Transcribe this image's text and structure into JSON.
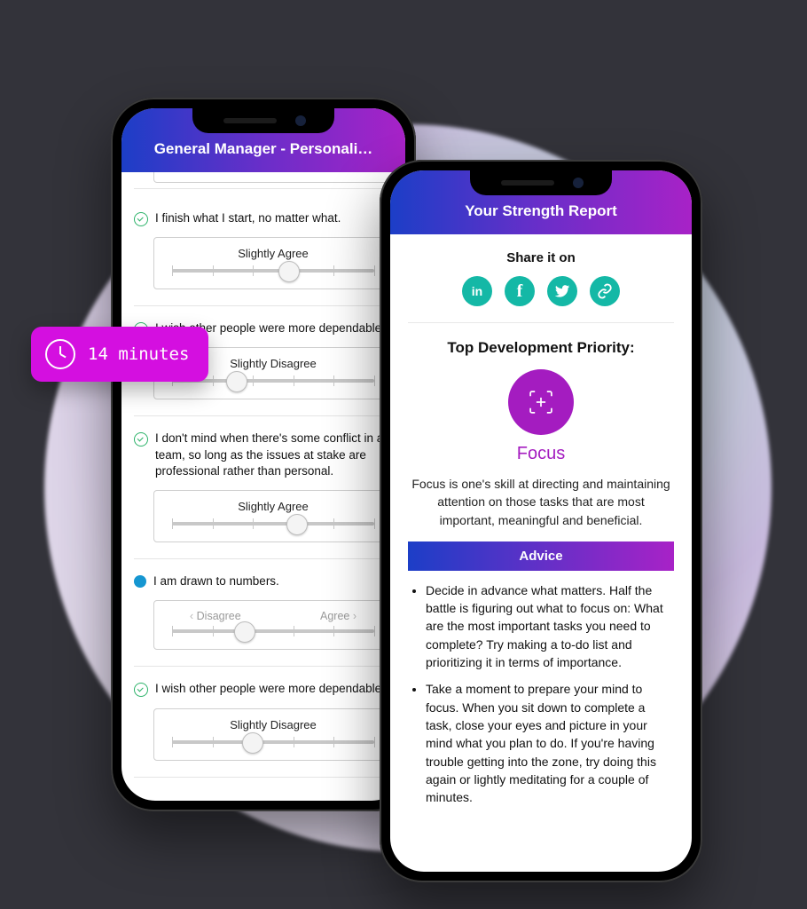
{
  "timePill": "14 minutes",
  "phoneA": {
    "title": "General Manager - Personali…",
    "questions": [
      {
        "status": "done",
        "text": "I finish what I start, no matter what.",
        "mode": "single",
        "valueLabel": "Slightly Agree",
        "thumbPct": 58
      },
      {
        "status": "done",
        "text": "I wish other people were more dependable.",
        "mode": "single",
        "valueLabel": "Slightly Disagree",
        "thumbPct": 32
      },
      {
        "status": "done",
        "text": "I don't mind when there's some conflict in a team, so long as the issues at stake are professional rather than personal.",
        "mode": "single",
        "valueLabel": "Slightly Agree",
        "thumbPct": 62
      },
      {
        "status": "active",
        "text": "I am drawn to numbers.",
        "mode": "range",
        "leftLabel": "Disagree",
        "rightLabel": "Agree",
        "thumbPct": 36
      },
      {
        "status": "done",
        "text": "I wish other people were more dependable.",
        "mode": "single",
        "valueLabel": "Slightly Disagree",
        "thumbPct": 40
      }
    ]
  },
  "phoneB": {
    "title": "Your Strength Report",
    "shareTitle": "Share it on",
    "shareButtons": [
      "linkedin",
      "facebook",
      "twitter",
      "link"
    ],
    "priorityHeading": "Top Development Priority:",
    "priorityName": "Focus",
    "priorityDesc": "Focus is one's skill at directing and maintaining attention on those tasks that are most important, meaningful and beneficial.",
    "adviceHeading": "Advice",
    "advice": [
      "Decide in advance what matters. Half the battle is figuring out what to focus on: What are the most important tasks you need to complete? Try making a to-do list and prioritizing it in terms of importance.",
      "Take a moment to prepare your mind to focus. When you sit down to complete a task, close your eyes and picture in your mind what you plan to do. If you're having trouble getting into the zone, try doing this again or lightly meditating for a couple of minutes."
    ]
  }
}
